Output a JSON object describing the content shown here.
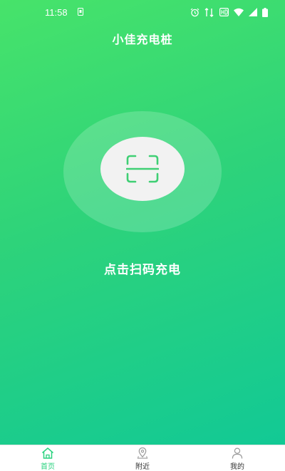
{
  "status_bar": {
    "time": "11:58"
  },
  "header": {
    "title": "小佳充电桩"
  },
  "scan": {
    "label": "点击扫码充电",
    "icon": "scan-icon"
  },
  "tabbar": {
    "active_color": "#2ad27f",
    "items": [
      {
        "label": "首页",
        "icon": "home-icon",
        "active": true
      },
      {
        "label": "附近",
        "icon": "location-icon",
        "active": false
      },
      {
        "label": "我的",
        "icon": "user-icon",
        "active": false
      }
    ]
  },
  "colors": {
    "gradient_start": "#47e36a",
    "gradient_end": "#12c995",
    "accent": "#2ad27f"
  }
}
